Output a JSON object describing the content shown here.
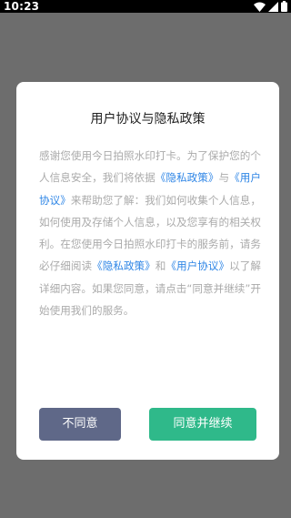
{
  "status_bar": {
    "time": "10:23"
  },
  "dialog": {
    "title": "用户协议与隐私政策",
    "body": {
      "p1": "感谢您使用今日拍照水印打卡。为了保护您的个人信息安全，我们将依据",
      "link_privacy_1": "《隐私政策》",
      "p2": "与",
      "link_user_1": "《用户协议》",
      "p3": "来帮助您了解：我们如何收集个人信息，如何使用及存储个人信息，以及您享有的相关权利。在您使用今日拍照水印打卡的服务前，请务必仔细阅读",
      "link_privacy_2": "《隐私政策》",
      "p4": "和",
      "link_user_2": "《用户协议》",
      "p5": "以了解详细内容。如果您同意，请点击“同意并继续”开始使用我们的服务。"
    },
    "buttons": {
      "disagree": "不同意",
      "agree": "同意并继续"
    }
  },
  "colors": {
    "overlay": "#6d6d6d",
    "link": "#2f86e6",
    "disagree_button": "#5f6888",
    "agree_button": "#2fb98a"
  },
  "icons": [
    "wifi-icon",
    "cellular-signal-icon",
    "battery-icon"
  ]
}
